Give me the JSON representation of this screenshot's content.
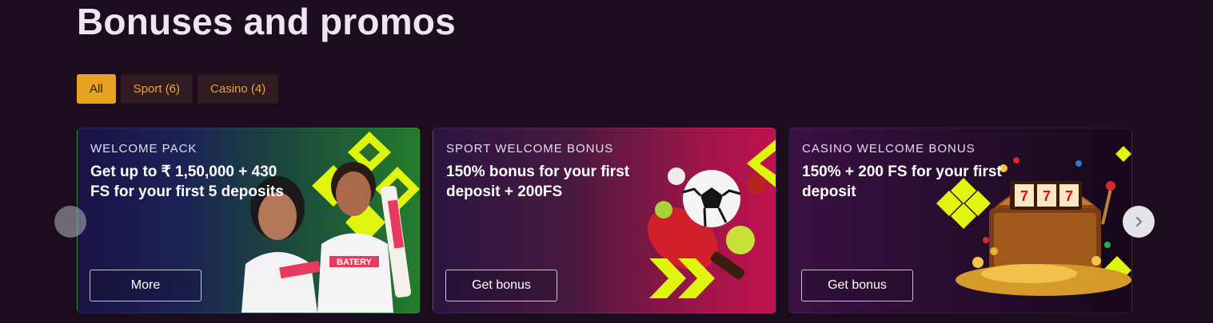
{
  "page": {
    "title": "Bonuses and promos"
  },
  "filters": [
    {
      "label": "All",
      "active": true
    },
    {
      "label": "Sport (6)",
      "active": false
    },
    {
      "label": "Casino (4)",
      "active": false
    }
  ],
  "cards": [
    {
      "kicker": "WELCOME PACK",
      "headline": "Get up to ₹ 1,50,000 + 430 FS for your first 5 deposits",
      "button": "More",
      "jersey_text": "BATERY"
    },
    {
      "kicker": "SPORT WELCOME BONUS",
      "headline": "150% bonus for your first deposit + 200FS",
      "button": "Get bonus"
    },
    {
      "kicker": "CASINO WELCOME BONUS",
      "headline": "150% + 200 FS for your first deposit",
      "button": "Get bonus"
    }
  ],
  "carousel": {
    "prev_icon": "chevron-left-icon",
    "next_icon": "chevron-right-icon"
  },
  "colors": {
    "background": "#1b0c1e",
    "accent": "#e9a323",
    "brand_lime": "#e4f80c"
  }
}
